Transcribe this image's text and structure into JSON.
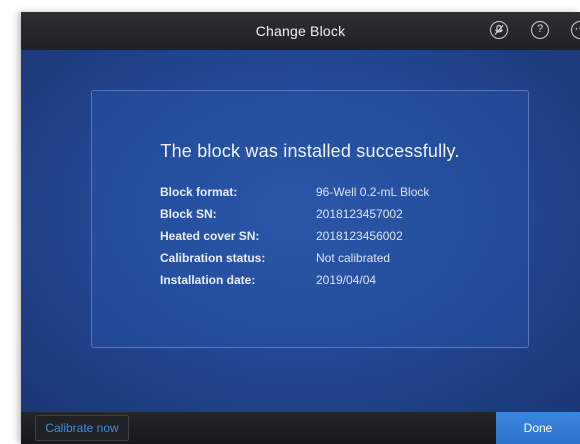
{
  "header": {
    "title": "Change Block",
    "icons": {
      "mute": "mute-icon",
      "help": "help-icon",
      "more": "more-icon"
    }
  },
  "card": {
    "heading": "The block was installed successfully.",
    "rows": [
      {
        "label": "Block format:",
        "value": "96-Well 0.2-mL Block"
      },
      {
        "label": "Block SN:",
        "value": "2018123457002"
      },
      {
        "label": "Heated cover SN:",
        "value": "2018123456002"
      },
      {
        "label": "Calibration status:",
        "value": "Not calibrated"
      },
      {
        "label": "Installation date:",
        "value": "2019/04/04"
      }
    ]
  },
  "footer": {
    "calibrate_label": "Calibrate now",
    "done_label": "Done"
  },
  "colors": {
    "accent": "#2f7bd6",
    "link": "#3d8fe0",
    "panel": "#234a96"
  }
}
